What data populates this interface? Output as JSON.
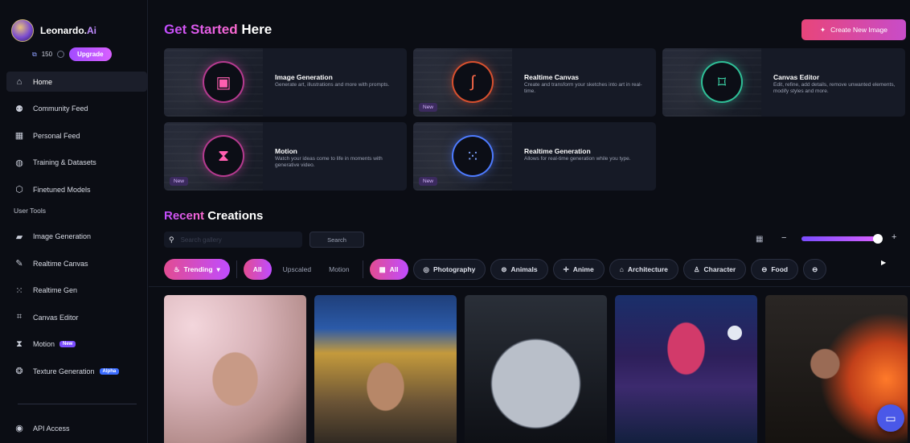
{
  "brand": {
    "name_main": "Leonardo.",
    "name_ai": "Ai"
  },
  "account": {
    "tokens": "150",
    "upgrade_label": "Upgrade"
  },
  "sidebar": {
    "items": [
      {
        "label": "Home",
        "icon": "home-icon",
        "active": true
      },
      {
        "label": "Community Feed",
        "icon": "community-icon"
      },
      {
        "label": "Personal Feed",
        "icon": "personal-feed-icon"
      },
      {
        "label": "Training & Datasets",
        "icon": "training-icon"
      },
      {
        "label": "Finetuned Models",
        "icon": "models-icon"
      }
    ],
    "section_label": "User Tools",
    "tools": [
      {
        "label": "Image Generation",
        "icon": "image-generation-icon"
      },
      {
        "label": "Realtime Canvas",
        "icon": "realtime-canvas-icon"
      },
      {
        "label": "Realtime Gen",
        "icon": "realtime-gen-icon"
      },
      {
        "label": "Canvas Editor",
        "icon": "canvas-editor-icon"
      },
      {
        "label": "Motion",
        "icon": "motion-icon",
        "badge": "New"
      },
      {
        "label": "Texture Generation",
        "icon": "texture-icon",
        "badge": "Alpha"
      }
    ],
    "api_label": "API Access"
  },
  "header": {
    "title_accent": "Get Started",
    "title_rest": " Here",
    "create_label": "Create New Image"
  },
  "cards": [
    {
      "title": "Image Generation",
      "desc": "Generate art, illustrations and more with prompts.",
      "new": ""
    },
    {
      "title": "Realtime Canvas",
      "desc": "Create and transform your sketches into art in real-time.",
      "new": "New"
    },
    {
      "title": "Canvas Editor",
      "desc": "Edit, refine, add details, remove unwanted elements, modify styles and more.",
      "new": ""
    },
    {
      "title": "Motion",
      "desc": "Watch your ideas come to life in moments with generative video.",
      "new": "New"
    },
    {
      "title": "Realtime Generation",
      "desc": "Allows for real-time generation while you type.",
      "new": "New"
    }
  ],
  "recent": {
    "title_accent": "Recent",
    "title_rest": " Creations",
    "search_placeholder": "Search gallery",
    "search_button": "Search",
    "zoom_level": 0.95
  },
  "filters": {
    "trending": "Trending",
    "type_tabs": [
      "All",
      "Upscaled",
      "Motion"
    ],
    "categories": [
      "All",
      "Photography",
      "Animals",
      "Anime",
      "Architecture",
      "Character",
      "Food"
    ]
  },
  "colors": {
    "accent_purple": "#c04cff",
    "accent_pink": "#e24c92",
    "chat_blue": "#4a58e8"
  }
}
